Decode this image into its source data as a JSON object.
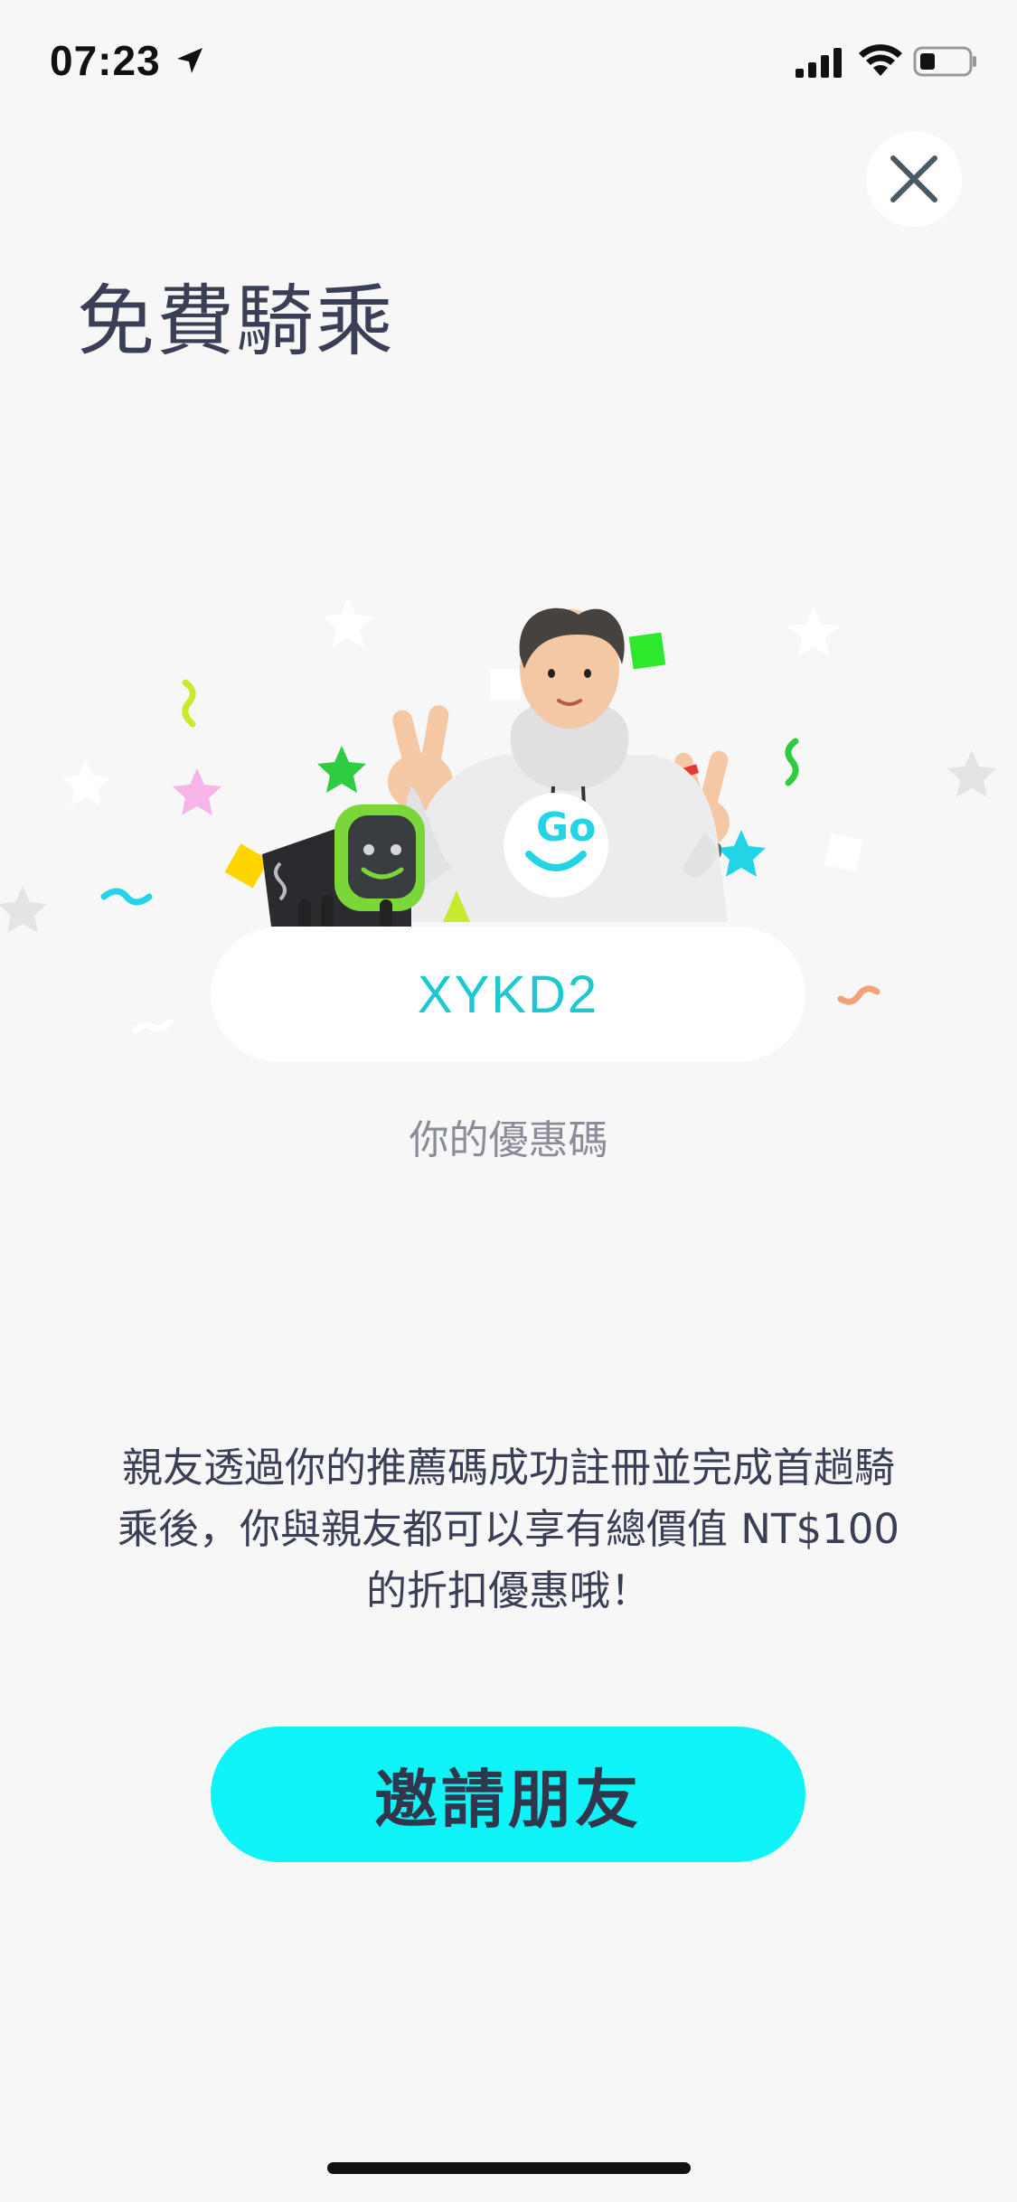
{
  "status_bar": {
    "time": "07:23",
    "icons": [
      "location-arrow-icon",
      "cellular-signal-icon",
      "wifi-icon",
      "battery-icon"
    ]
  },
  "header": {
    "title": "免費騎乘",
    "close_icon": "close-icon"
  },
  "referral": {
    "code": "XYKD2",
    "code_caption": "你的優惠碼"
  },
  "description": {
    "line1": "親友透過你的推薦碼成功註冊並完成首趟騎",
    "line2": "乘後，你與親友都可以享有總價值 NT$100",
    "line3": "的折扣優惠哦！"
  },
  "actions": {
    "invite_label": "邀請朋友"
  },
  "hero_illustration": {
    "shirt_logo_text": "Go"
  },
  "colors": {
    "background": "#f7f7f8",
    "accent_cyan": "#0ef3f5",
    "code_text": "#1fc7d1",
    "title_text": "#3b3f55",
    "robot_green": "#7bd639"
  }
}
